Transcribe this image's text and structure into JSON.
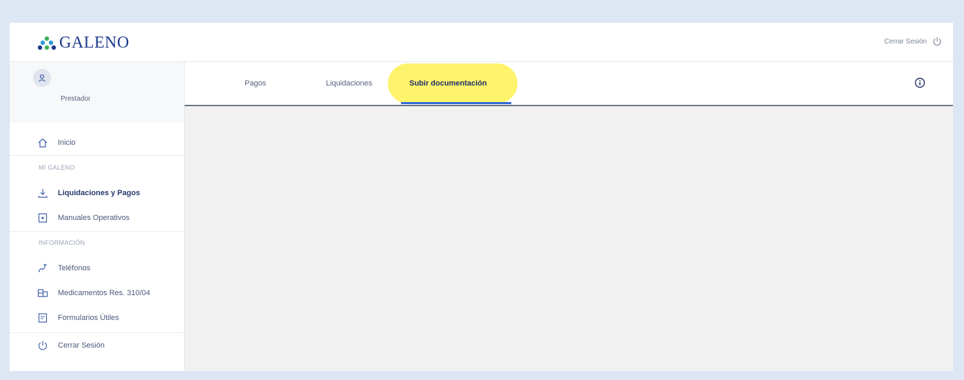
{
  "brand": {
    "name": "GALENO"
  },
  "header": {
    "logout_label": "Cerrar Sesión"
  },
  "user": {
    "role": "Prestador"
  },
  "sidebar": {
    "home": "Inicio",
    "section1": "MI GALENO",
    "items1": [
      "Liquidaciones y Pagos",
      "Manuales Operativos"
    ],
    "section2": "INFORMACIÓN",
    "items2": [
      "Teléfonos",
      "Medicamentos Res. 310/04",
      "Formularios Útiles"
    ],
    "logout": "Cerrar Sesión"
  },
  "tabs": [
    "Pagos",
    "Liquidaciones",
    "Subir documentación"
  ],
  "active_tab": "Subir documentación",
  "colors": {
    "brand": "#1e3a8c",
    "highlight": "#fef36c",
    "active_underline": "#2e6bd6"
  }
}
